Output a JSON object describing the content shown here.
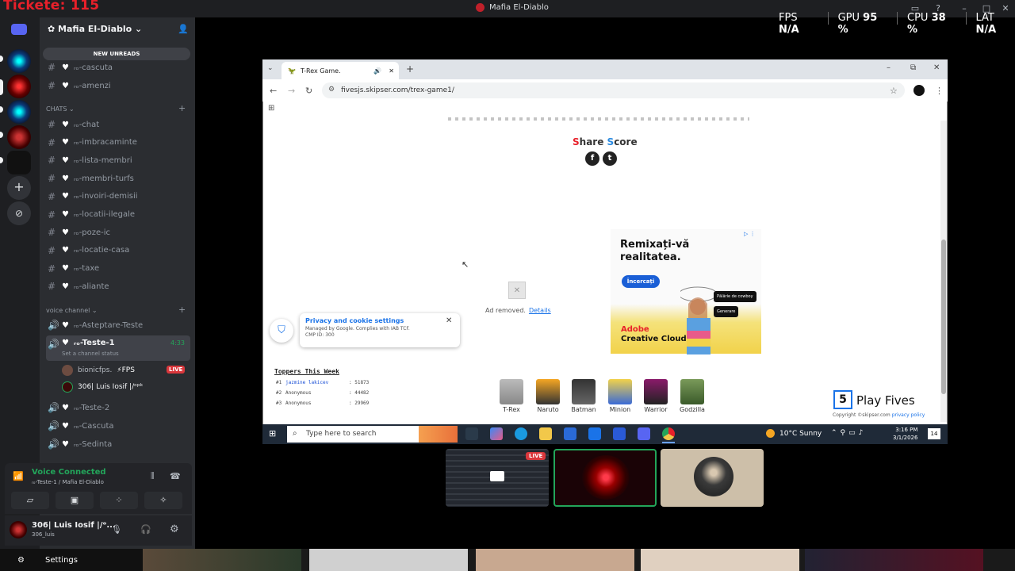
{
  "overlay": {
    "ticket_text": "Tickete: 115"
  },
  "window": {
    "title": "Mafia El-Diablo"
  },
  "perf": {
    "fps_label": "FPS",
    "fps_value": "N/A",
    "gpu_label": "GPU",
    "gpu_value": "95 %",
    "cpu_label": "CPU",
    "cpu_value": "38 %",
    "lat_label": "LAT",
    "lat_value": "N/A"
  },
  "sidebar": {
    "server_name": "Mafia El-Diablo",
    "new_unreads": "NEW UNREADS",
    "top_channels": [
      {
        "name": "ᵣₒ-cascuta"
      },
      {
        "name": "ᵣₒ-amenzi"
      }
    ],
    "chats_category": "CHATS",
    "chat_channels": [
      {
        "name": "ᵣₒ-chat"
      },
      {
        "name": "ᵣₒ-imbracaminte"
      },
      {
        "name": "ᵣₒ-lista-membri"
      },
      {
        "name": "ᵣₒ-membri-turfs"
      },
      {
        "name": "ᵣₒ-invoiri-demisii"
      },
      {
        "name": "ᵣₒ-locatii-ilegale"
      },
      {
        "name": "ᵣₒ-poze-ic"
      },
      {
        "name": "ᵣₒ-locatie-casa"
      },
      {
        "name": "ᵣₒ-taxe"
      },
      {
        "name": "ᵣₒ-aliante"
      }
    ],
    "voice_category": "voice channel",
    "voice_channels": [
      {
        "name": "ᵣₒ-Asteptare-Teste"
      },
      {
        "name": "ᵣₒ-Teste-1",
        "timer": "4:33",
        "status": "Set a channel status"
      },
      {
        "name": "ᵣₒ-Teste-2"
      },
      {
        "name": "ᵣₒ-Cascuta"
      },
      {
        "name": "ᵣₒ-Sedinta"
      }
    ],
    "voice_users": [
      {
        "name": "bionicfps.",
        "tag": "⚡FPS",
        "badge": "LIVE"
      },
      {
        "name": "306| Luis Iosif |/ᵒᵖᵏ"
      }
    ]
  },
  "voice_panel": {
    "status": "Voice Connected",
    "channel": "ᵣₒ-Teste-1 / Mafia El-Diablo"
  },
  "user_panel": {
    "name": "306| Luis Iosif |/ᵒ...",
    "tag": "306_luis"
  },
  "settings_label": "Settings",
  "browser": {
    "tab_title": "T-Rex Game.",
    "url": "fivesjs.skipser.com/trex-game1/",
    "share_title": "Share Score",
    "share_icons": [
      "facebook-icon",
      "twitter-icon"
    ],
    "cookie": {
      "title": "Privacy and cookie settings",
      "sub1": "Managed by Google. Complies with IAB TCF.",
      "sub2": "CMP ID: 300"
    },
    "ad_removed": "Ad removed.",
    "ad_details": "Details",
    "ad": {
      "headline": "Remixați-vă realitatea.",
      "button": "Încercați",
      "pill1": "Pălărie de cowboy",
      "pill2": "Generare",
      "brand1": "Adobe",
      "brand2": "Creative Cloud"
    },
    "toppers_title": "Toppers This Week",
    "toppers": [
      {
        "rank": "#1",
        "name": "jazmine lakicev",
        "score": ": 51873"
      },
      {
        "rank": "#2",
        "name": "Anonymous",
        "score": ": 44482"
      },
      {
        "rank": "#3",
        "name": "Anonymous",
        "score": ": 29969"
      }
    ],
    "characters": [
      "T-Rex",
      "Naruto",
      "Batman",
      "Minion",
      "Warrior",
      "Godzilla"
    ],
    "brand": {
      "logo": "5",
      "name": "Play Fives",
      "copyright": "Copyright ©skipser.com",
      "policy": "privacy policy"
    }
  },
  "taskbar": {
    "search_placeholder": "Type here to search",
    "weather": "10°C  Sunny",
    "time": "3:16 PM",
    "date": "3/1/2026",
    "notif_count": "14"
  },
  "streams": {
    "live_badge": "LIVE"
  }
}
